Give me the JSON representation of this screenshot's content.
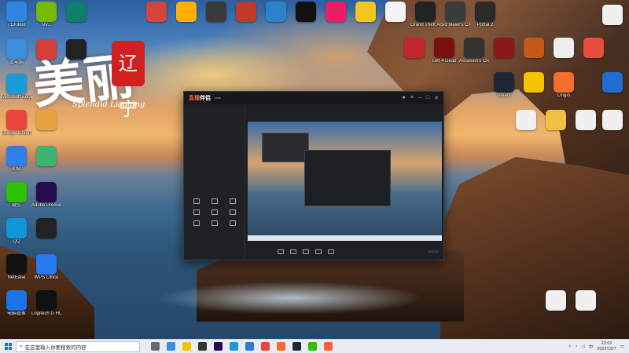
{
  "calligraphy": {
    "main": "美丽",
    "seal": "辽宁",
    "subtitle": "Splendid Liaoning"
  },
  "desktop_icons": [
    {
      "id": "icon-1",
      "label": "7130888",
      "color": "#2e86de"
    },
    {
      "id": "icon-2",
      "label": "NV...",
      "color": "#76b900"
    },
    {
      "id": "icon-3",
      "label": "",
      "color": "#0f7d6b"
    },
    {
      "id": "icon-4",
      "label": "此电脑",
      "color": "#3b8ed8"
    },
    {
      "id": "icon-5",
      "label": "",
      "color": "#d43f3a"
    },
    {
      "id": "icon-6",
      "label": "",
      "color": "#222"
    },
    {
      "id": "icon-7",
      "label": "Microsoft Edge",
      "color": "#1a9ad6"
    },
    {
      "id": "icon-8",
      "label": "Google Chrome",
      "color": "#e8453c"
    },
    {
      "id": "icon-9",
      "label": "KIM",
      "color": "#2f80ed"
    },
    {
      "id": "icon-10",
      "label": "微信",
      "color": "#2dc100"
    },
    {
      "id": "icon-11",
      "label": "QQ",
      "color": "#1296db"
    },
    {
      "id": "icon-12",
      "label": "Adobe Premiere P...",
      "color": "#2a0a4f"
    },
    {
      "id": "icon-13",
      "label": "",
      "color": "#222"
    },
    {
      "id": "icon-14",
      "label": "NetEase",
      "color": "#111"
    },
    {
      "id": "icon-15",
      "label": "WPS Office",
      "color": "#2878f0"
    },
    {
      "id": "icon-16",
      "label": "电脑管家",
      "color": "#1a73e8"
    },
    {
      "id": "icon-17",
      "label": "Logitech G HUB",
      "color": "#111"
    },
    {
      "id": "icon-18",
      "label": "",
      "color": "#e6a23c"
    },
    {
      "id": "icon-19",
      "label": "",
      "color": "#3cb371"
    },
    {
      "id": "icon-20",
      "label": "",
      "color": "#d0463d"
    },
    {
      "id": "icon-21",
      "label": "",
      "color": "#ffb000"
    },
    {
      "id": "icon-22",
      "label": "",
      "color": "#3a3a3a"
    },
    {
      "id": "icon-23",
      "label": "",
      "color": "#c0392b"
    },
    {
      "id": "icon-24",
      "label": "",
      "color": "#2c82c9"
    },
    {
      "id": "icon-25",
      "label": "",
      "color": "#111"
    },
    {
      "id": "icon-26",
      "label": "",
      "color": "#e91e63"
    },
    {
      "id": "icon-27",
      "label": "",
      "color": "#f3c623"
    },
    {
      "id": "icon-28",
      "label": "",
      "color": "#f4f4f4"
    },
    {
      "id": "icon-29",
      "label": "Grand Theft Auto IV Th...",
      "color": "#222"
    },
    {
      "id": "icon-30",
      "label": "Sid Meier's Civilizati...",
      "color": "#3b3b3b"
    },
    {
      "id": "icon-31",
      "label": "Portal 2",
      "color": "#2a2a2a"
    },
    {
      "id": "icon-32",
      "label": "",
      "color": "#c1272d"
    },
    {
      "id": "icon-33",
      "label": "Left 4 Dead",
      "color": "#7a1010"
    },
    {
      "id": "icon-34",
      "label": "Assassin's Creed",
      "color": "#333"
    },
    {
      "id": "icon-35",
      "label": "",
      "color": "#8a1a1a"
    },
    {
      "id": "icon-36",
      "label": "",
      "color": "#c45a16"
    },
    {
      "id": "icon-37",
      "label": "",
      "color": "#eee"
    },
    {
      "id": "icon-38",
      "label": "",
      "color": "#e74c3c"
    },
    {
      "id": "icon-39",
      "label": "",
      "color": "#1f6fd1"
    },
    {
      "id": "icon-40",
      "label": "Steam",
      "color": "#1b2838"
    },
    {
      "id": "icon-41",
      "label": "",
      "color": "#f5c400"
    },
    {
      "id": "icon-42",
      "label": "Origin",
      "color": "#f56c2d"
    },
    {
      "id": "icon-43",
      "label": "",
      "color": "#f0f0f0"
    },
    {
      "id": "icon-44",
      "label": "",
      "color": "#f0f0f0"
    },
    {
      "id": "icon-45",
      "label": "",
      "color": "#f0c040"
    },
    {
      "id": "icon-46",
      "label": "",
      "color": "#f0f0f0"
    },
    {
      "id": "icon-47",
      "label": "",
      "color": "#f0f0f0"
    },
    {
      "id": "icon-48",
      "label": "",
      "color": "#f0f0f0"
    },
    {
      "id": "icon-49",
      "label": "",
      "color": "#f0f0f0"
    }
  ],
  "app_window": {
    "logo_prefix": "直播",
    "logo_suffix": "伴侣",
    "plan_badge": "",
    "side_tabs": [
      "",
      "",
      ""
    ],
    "scene_label": "",
    "tools_title": "",
    "tools": [
      "",
      "",
      "",
      "",
      "",
      "",
      "",
      "",
      ""
    ],
    "side_footer": "",
    "main_tabs": [
      "",
      ""
    ],
    "main_sub": [
      "",
      "",
      "",
      ""
    ],
    "bottom_items": [
      "",
      "",
      "",
      "",
      ""
    ],
    "live_button": ""
  },
  "taskbar": {
    "search_placeholder": "在这里输入你要搜索的内容",
    "time": "22:02",
    "date": "2022/10/7"
  }
}
